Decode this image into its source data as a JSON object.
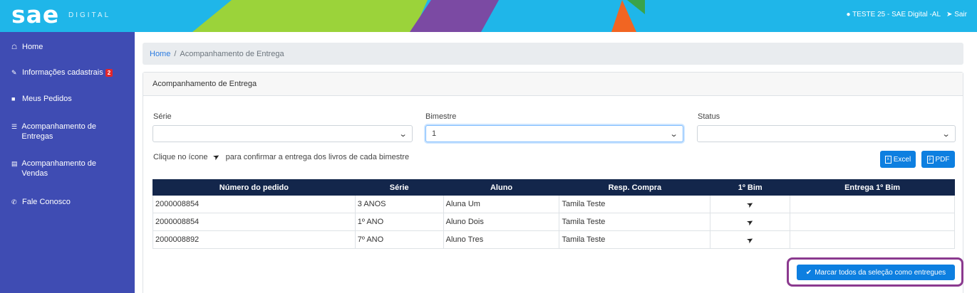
{
  "header": {
    "logo": "sae",
    "logo_sub": "DIGITAL",
    "user": "TESTE 25 - SAE Digital -AL",
    "logout": "Sair",
    "colors": {
      "bar": "#1fb6e9",
      "green": "#9bd33a",
      "purple": "#7b4aa3",
      "orange": "#f16522"
    }
  },
  "sidebar": {
    "items": [
      {
        "label": "Home",
        "icon": "home-icon"
      },
      {
        "label": "Informações cadastrais",
        "icon": "edit-icon",
        "badge": "2"
      },
      {
        "label": "Meus Pedidos",
        "icon": "books-icon"
      },
      {
        "label": "Acompanhamento de Entregas",
        "icon": "list-icon"
      },
      {
        "label": "Acompanhamento de Vendas",
        "icon": "cash-icon"
      },
      {
        "label": "Fale Conosco",
        "icon": "phone-icon"
      }
    ]
  },
  "breadcrumb": {
    "home": "Home",
    "sep": "/",
    "current": "Acompanhamento de Entrega"
  },
  "card": {
    "title": "Acompanhamento de Entrega"
  },
  "filters": {
    "serie": {
      "label": "Série",
      "value": ""
    },
    "bimestre": {
      "label": "Bimestre",
      "value": "1"
    },
    "status": {
      "label": "Status",
      "value": ""
    }
  },
  "hint": {
    "before": "Clique no ícone",
    "after": "para confirmar a entrega dos livros de cada bimestre"
  },
  "export": {
    "excel": "Excel",
    "pdf": "PDF"
  },
  "table": {
    "headers": [
      "Número do pedido",
      "Série",
      "Aluno",
      "Resp. Compra",
      "1º Bim",
      "Entrega 1º Bim"
    ],
    "rows": [
      {
        "pedido": "2000008854",
        "serie": "3 ANOS",
        "aluno": "Aluna Um",
        "resp": "Tamila Teste",
        "entrega": ""
      },
      {
        "pedido": "2000008854",
        "serie": "1º ANO",
        "aluno": "Aluno Dois",
        "resp": "Tamila Teste",
        "entrega": ""
      },
      {
        "pedido": "2000008892",
        "serie": "7º ANO",
        "aluno": "Aluno Tres",
        "resp": "Tamila Teste",
        "entrega": ""
      }
    ]
  },
  "mark_all": {
    "label": "Marcar todos da seleção como entregues"
  }
}
